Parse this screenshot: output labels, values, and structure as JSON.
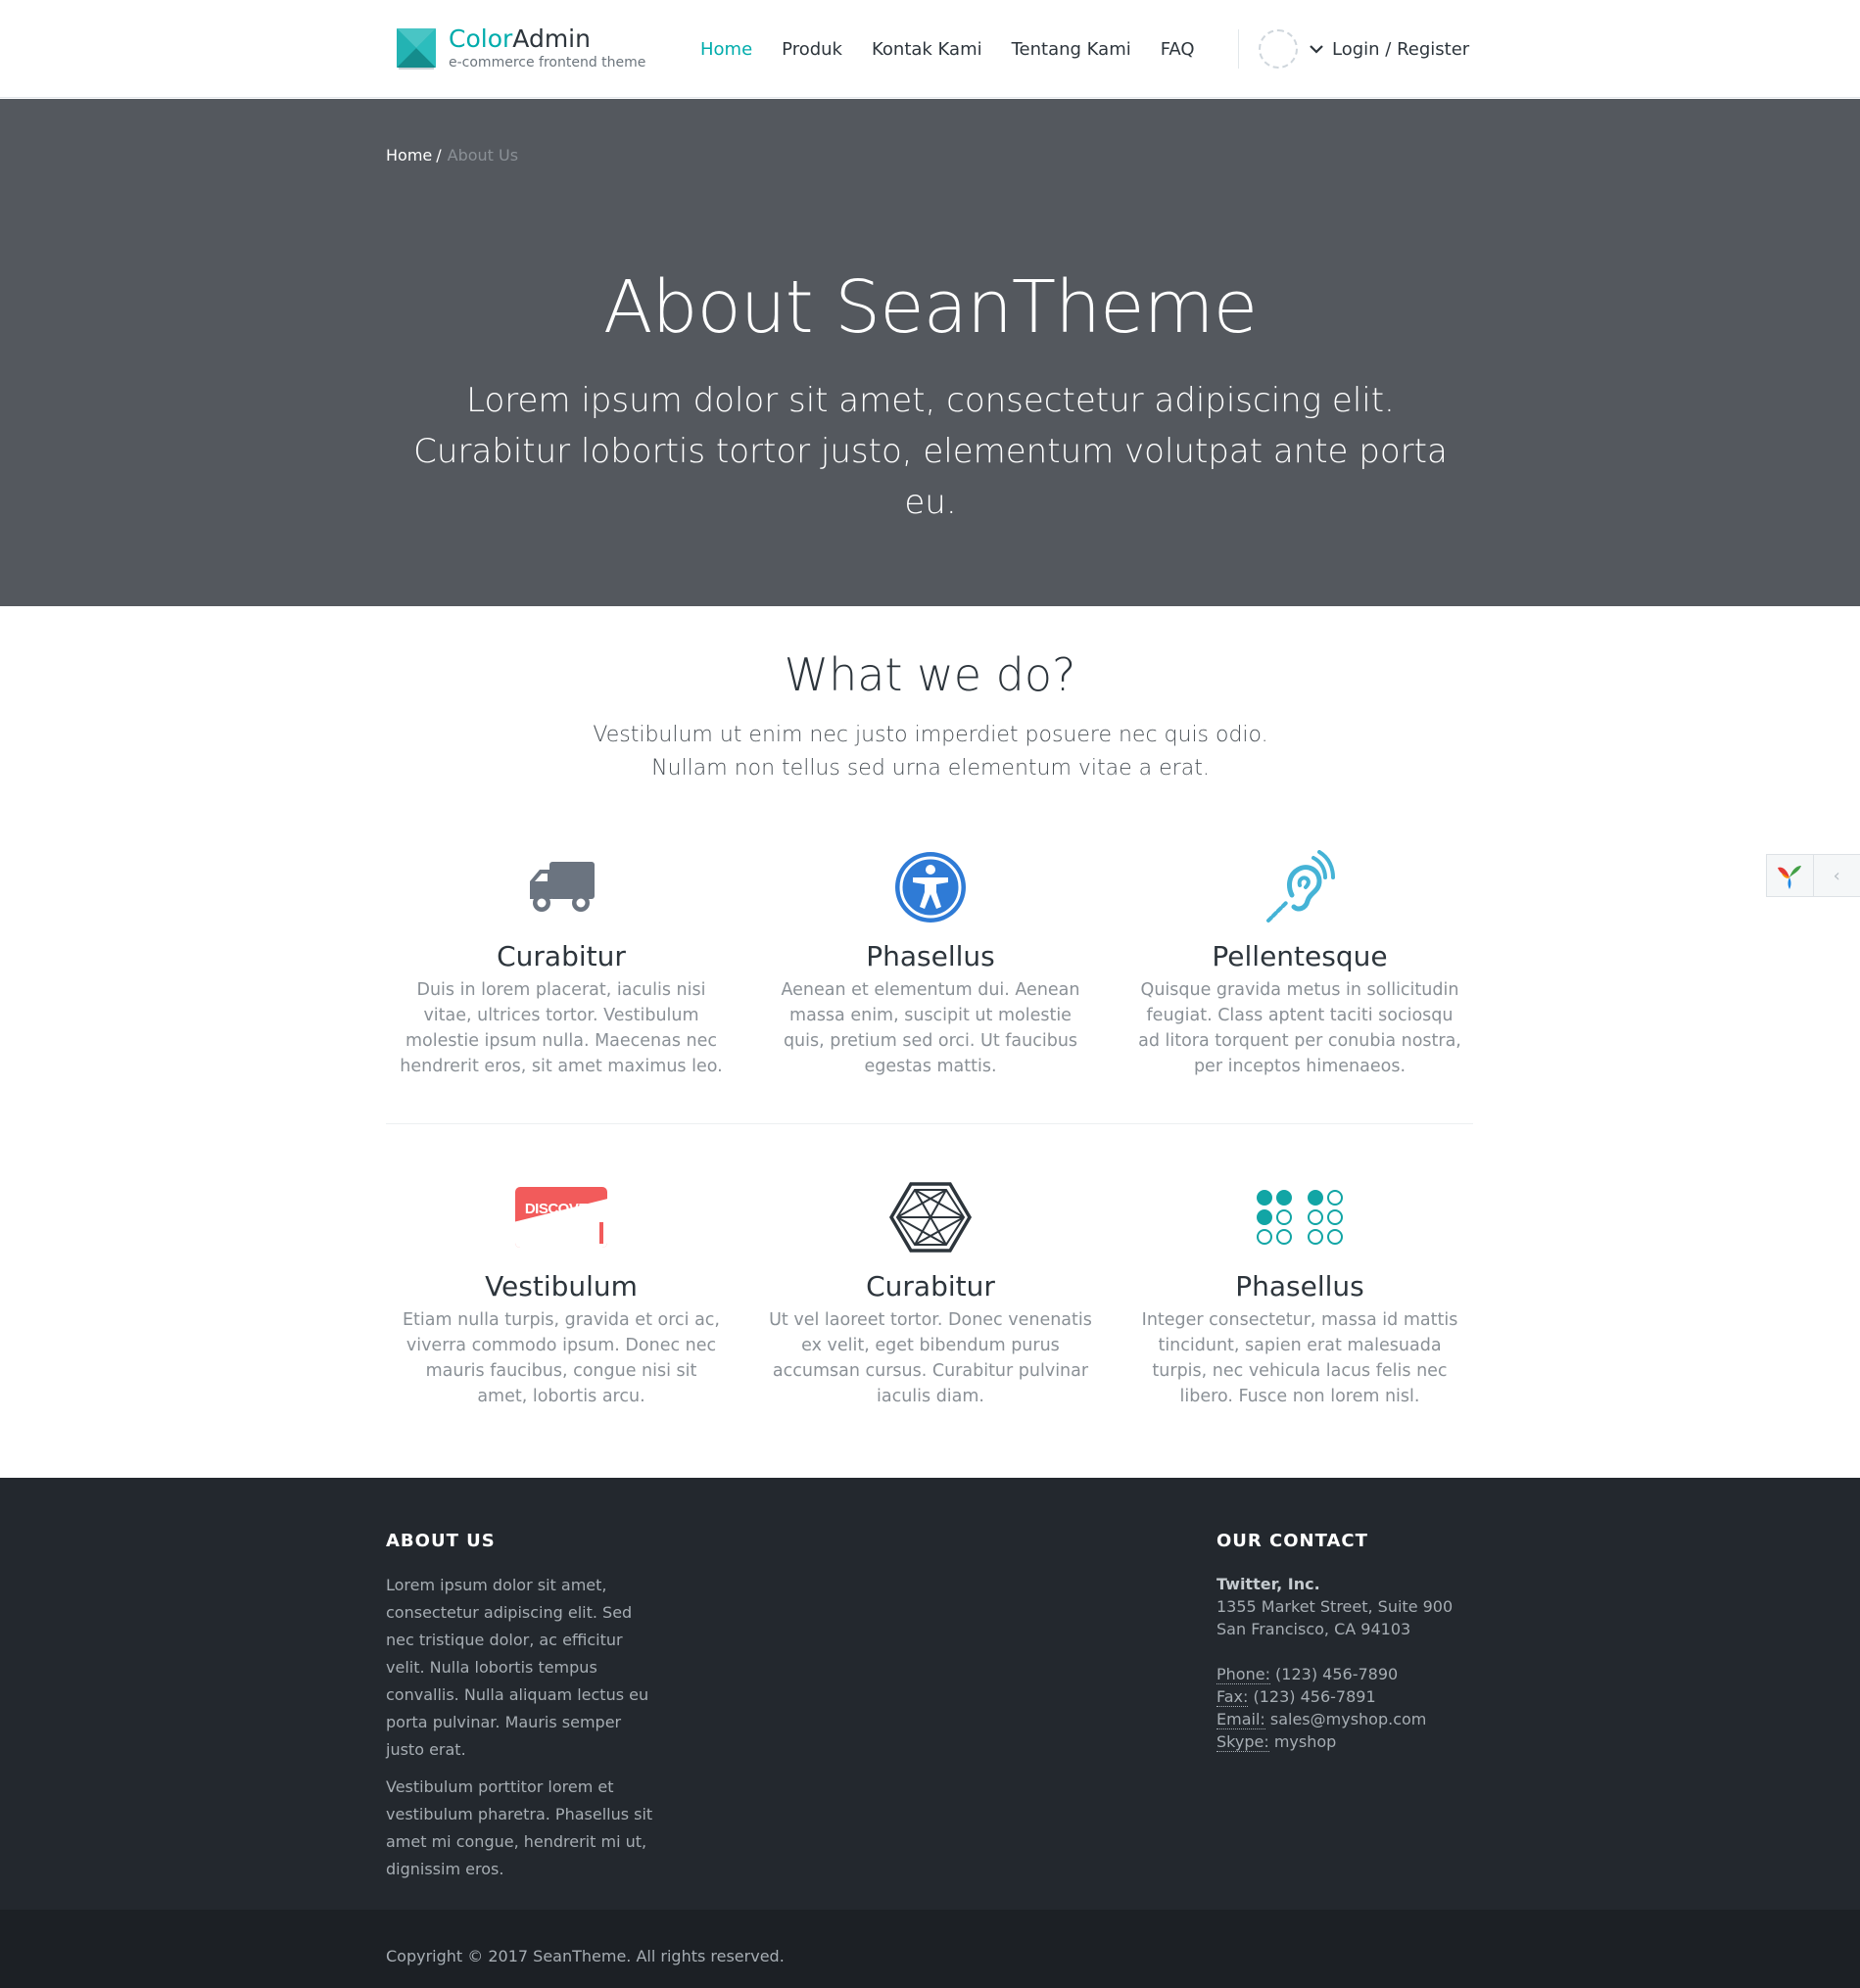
{
  "header": {
    "brand_name_part1": "Color",
    "brand_name_part2": "Admin",
    "brand_subtitle": "e-commerce frontend theme",
    "nav": [
      {
        "label": "Home",
        "active": true
      },
      {
        "label": "Produk",
        "active": false
      },
      {
        "label": "Kontak Kami",
        "active": false
      },
      {
        "label": "Tentang Kami",
        "active": false
      },
      {
        "label": "FAQ",
        "active": false
      }
    ],
    "login_label": "Login / Register",
    "accent_color": "#00acac"
  },
  "hero": {
    "breadcrumb": {
      "home": "Home",
      "separator": "/",
      "current": "About Us"
    },
    "title": "About SeanTheme",
    "description": "Lorem ipsum dolor sit amet, consectetur adipiscing elit. Curabitur lobortis tortor justo, elementum volutpat ante porta eu.",
    "background_color": "#54585e"
  },
  "features": {
    "title": "What we do?",
    "description_line1": "Vestibulum ut enim nec justo imperdiet posuere nec quis odio.",
    "description_line2": "Nullam non tellus sed urna elementum vitae a erat.",
    "items": [
      {
        "icon": "truck-icon",
        "title": "Curabitur",
        "text": "Duis in lorem placerat, iaculis nisi vitae, ultrices tortor. Vestibulum molestie ipsum nulla. Maecenas nec hendrerit eros, sit amet maximus leo."
      },
      {
        "icon": "universal-access-icon",
        "title": "Phasellus",
        "text": "Aenean et elementum dui. Aenean massa enim, suscipit ut molestie quis, pretium sed orci. Ut faucibus egestas mattis."
      },
      {
        "icon": "assistive-listening-icon",
        "title": "Pellentesque",
        "text": "Quisque gravida metus in sollicitudin feugiat. Class aptent taciti sociosqu ad litora torquent per conubia nostra, per inceptos himenaeos."
      },
      {
        "icon": "discover-card-icon",
        "title": "Vestibulum",
        "text": "Etiam nulla turpis, gravida et orci ac, viverra commodo ipsum. Donec nec mauris faucibus, congue nisi sit amet, lobortis arcu."
      },
      {
        "icon": "hexagon-network-icon",
        "title": "Curabitur",
        "text": "Ut vel laoreet tortor. Donec venenatis ex velit, eget bibendum purus accumsan cursus. Curabitur pulvinar iaculis diam."
      },
      {
        "icon": "braille-icon",
        "title": "Phasellus",
        "text": "Integer consectetur, massa id mattis tincidunt, sapien erat malesuada turpis, nec vehicula lacus felis nec libero. Fusce non lorem nisl."
      }
    ],
    "discover_label": "DISCOVER"
  },
  "footer": {
    "about_heading": "ABOUT US",
    "about_p1": "Lorem ipsum dolor sit amet, consectetur adipiscing elit. Sed nec tristique dolor, ac efficitur velit. Nulla lobortis tempus convallis. Nulla aliquam lectus eu porta pulvinar. Mauris semper justo erat.",
    "about_p2": "Vestibulum porttitor lorem et vestibulum pharetra. Phasellus sit amet mi congue, hendrerit mi ut, dignissim eros.",
    "contact_heading": "OUR CONTACT",
    "company": "Twitter, Inc.",
    "address1": "1355 Market Street, Suite 900",
    "address2": "San Francisco, CA 94103",
    "phone_label": "Phone:",
    "phone": "(123) 456-7890",
    "fax_label": "Fax:",
    "fax": "(123) 456-7891",
    "email_label": "Email:",
    "email": "sales@myshop.com",
    "skype_label": "Skype:",
    "skype": "myshop",
    "copyright": "Copyright © 2017 SeanTheme. All rights reserved."
  }
}
